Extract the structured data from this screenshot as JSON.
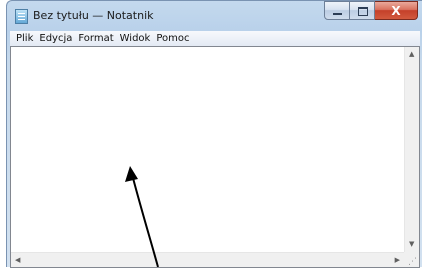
{
  "window": {
    "title": "Bez tytułu — Notatnik",
    "icon": "notepad-icon"
  },
  "caption_buttons": {
    "minimize_icon": "minimize-icon",
    "maximize_icon": "maximize-icon",
    "close_glyph": "X",
    "close_color": "#c4402a"
  },
  "menu": {
    "items": [
      {
        "label": "Plik"
      },
      {
        "label": "Edycja"
      },
      {
        "label": "Format"
      },
      {
        "label": "Widok"
      },
      {
        "label": "Pomoc"
      }
    ]
  },
  "editor": {
    "text": ""
  },
  "scrollbars": {
    "up_arrow": "▲",
    "down_arrow": "▼",
    "left_arrow": "◀",
    "right_arrow": "▶"
  },
  "annotation": {
    "icon": "annotation-arrow-icon",
    "color": "#000000"
  }
}
